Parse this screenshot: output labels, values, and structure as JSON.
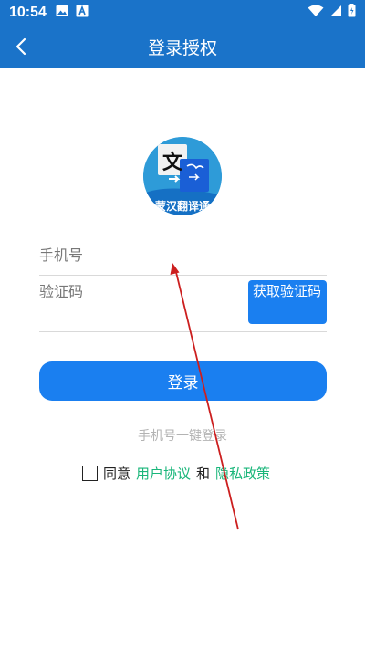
{
  "status_bar": {
    "time": "10:54",
    "left_icons": [
      "image-icon",
      "a-icon"
    ],
    "right_icons": [
      "wifi-icon",
      "cellular-icon",
      "battery-icon"
    ]
  },
  "app_bar": {
    "title": "登录授权",
    "back_icon": "chevron-left-icon"
  },
  "logo": {
    "text_char": "文",
    "caption": "蒙汉翻译通"
  },
  "form": {
    "phone_placeholder": "手机号",
    "code_placeholder": "验证码",
    "get_code_label": "获取验证码"
  },
  "login_button_label": "登录",
  "one_click_login_label": "手机号一键登录",
  "agreement": {
    "agree_text": "同意",
    "user_agreement": "用户协议",
    "and_text": "和",
    "privacy_policy": "隐私政策",
    "checked": false
  },
  "colors": {
    "primary": "#1a73c9",
    "button": "#1a7ff0",
    "link": "#19b67a",
    "annotation_arrow": "#cc1f1f"
  }
}
